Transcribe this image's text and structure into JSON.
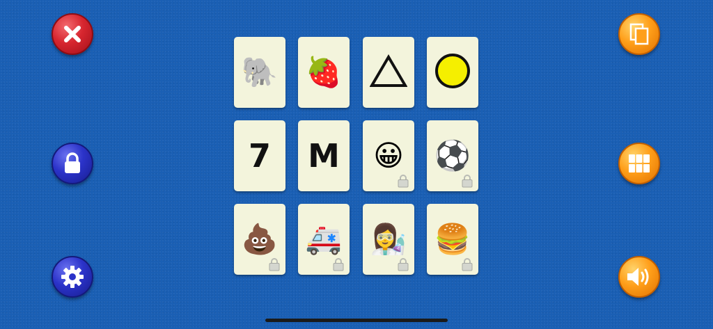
{
  "buttons": {
    "close": {
      "icon": "close-icon",
      "color": "#d7262f"
    },
    "lock": {
      "icon": "lock-icon",
      "color": "#2b33c9"
    },
    "settings": {
      "icon": "gear-icon",
      "color": "#2b33c9"
    },
    "copy": {
      "icon": "copy-icon",
      "color": "#ff9f1a"
    },
    "grid": {
      "icon": "grid-icon",
      "color": "#ff9f1a"
    },
    "sound": {
      "icon": "speaker-icon",
      "color": "#ff9f1a"
    }
  },
  "cards": [
    {
      "content": "🐘",
      "kind": "emoji",
      "locked": false,
      "name": "elephant"
    },
    {
      "content": "🍓",
      "kind": "emoji",
      "locked": false,
      "name": "strawberry"
    },
    {
      "content": "",
      "kind": "triangle",
      "locked": false,
      "name": "triangle"
    },
    {
      "content": "",
      "kind": "circle",
      "locked": false,
      "name": "circle",
      "fill": "#f5ef00"
    },
    {
      "content": "7",
      "kind": "text",
      "locked": false,
      "name": "number-seven"
    },
    {
      "content": "M",
      "kind": "text",
      "locked": false,
      "name": "letter-m"
    },
    {
      "content": "😀",
      "kind": "emoji",
      "locked": true,
      "name": "smiley"
    },
    {
      "content": "⚽",
      "kind": "emoji",
      "locked": true,
      "name": "soccer-ball"
    },
    {
      "content": "💩",
      "kind": "emoji",
      "locked": true,
      "name": "poop"
    },
    {
      "content": "🚑",
      "kind": "emoji",
      "locked": true,
      "name": "ambulance"
    },
    {
      "content": "👩‍🔬",
      "kind": "emoji",
      "locked": true,
      "name": "scientist"
    },
    {
      "content": "🍔",
      "kind": "emoji",
      "locked": true,
      "name": "hamburger"
    }
  ]
}
